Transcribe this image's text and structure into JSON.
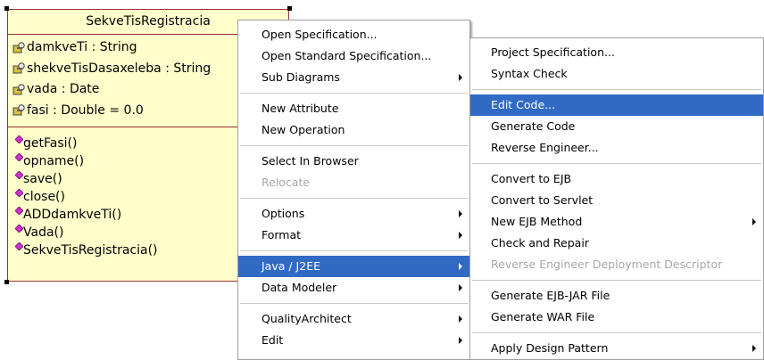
{
  "uml_class": {
    "name": "SekveTisRegistracia",
    "attributes": [
      "damkveTi : String",
      "shekveTisDasaxeleba : String",
      "vada : Date",
      "fasi : Double = 0.0"
    ],
    "operations": [
      "getFasi()",
      "opname()",
      "save()",
      "close()",
      "ADDdamkveTi()",
      "Vada()",
      "SekveTisRegistracia()"
    ]
  },
  "context_menu": {
    "items": {
      "open_specification": "Open Specification...",
      "open_standard_specification": "Open Standard Specification...",
      "sub_diagrams": "Sub Diagrams",
      "new_attribute": "New Attribute",
      "new_operation": "New Operation",
      "select_in_browser": "Select In Browser",
      "relocate": "Relocate",
      "options": "Options",
      "format": "Format",
      "java_j2ee": "Java / J2EE",
      "data_modeler": "Data Modeler",
      "quality_architect": "QualityArchitect",
      "edit": "Edit"
    }
  },
  "java_submenu": {
    "items": {
      "project_specification": "Project Specification...",
      "syntax_check": "Syntax Check",
      "edit_code": "Edit Code...",
      "generate_code": "Generate Code",
      "reverse_engineer": "Reverse Engineer...",
      "convert_to_ejb": "Convert to EJB",
      "convert_to_servlet": "Convert to Servlet",
      "new_ejb_method": "New EJB Method",
      "check_and_repair": "Check and Repair",
      "reverse_engineer_deployment_descriptor": "Reverse Engineer Deployment Descriptor",
      "generate_ejb_jar_file": "Generate EJB-JAR File",
      "generate_war_file": "Generate WAR File",
      "apply_design_pattern": "Apply Design Pattern"
    }
  },
  "colors": {
    "class_fill": "#ffffcc",
    "class_border": "#993333",
    "menu_highlight": "#316ac5",
    "disabled_text": "#a8a8a8",
    "operation_icon": "#cc33cc"
  },
  "icons": {
    "attribute": "protected-attribute-key-icon",
    "operation": "public-operation-diamond-icon",
    "submenu": "submenu-arrow-icon"
  }
}
